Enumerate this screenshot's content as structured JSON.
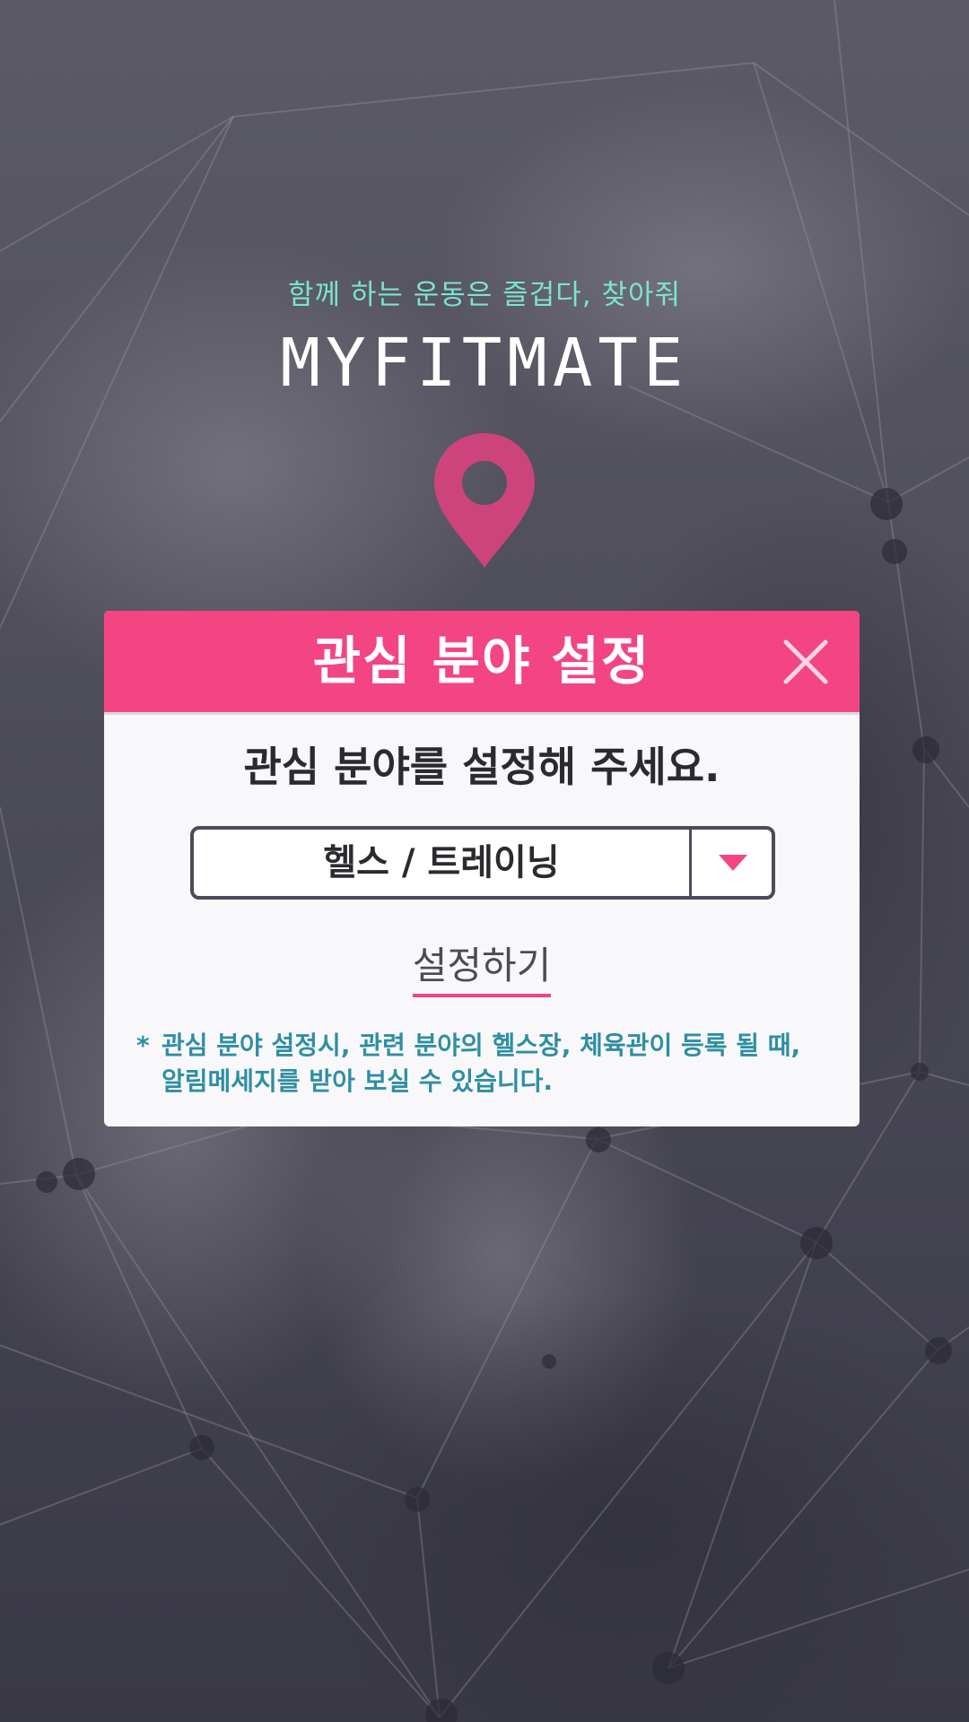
{
  "header": {
    "tagline": "함께 하는 운동은 즐겁다, 찾아줘",
    "brand": "MYFITMATE"
  },
  "icons": {
    "pin": "map-pin-icon",
    "close": "close-icon",
    "dropdown": "triangle-down-icon"
  },
  "modal": {
    "title": "관심 분야 설정",
    "subtitle": "관심 분야를 설정해 주세요.",
    "select": {
      "selected": "헬스 / 트레이닝"
    },
    "submit_label": "설정하기",
    "notice_marker": "*",
    "notice_lines": [
      "관심 분야 설정시, 관련 분야의 헬스장, 체육관이 등록 될 때,",
      "알림메세지를 받아 보실 수 있습니다."
    ]
  },
  "colors": {
    "accent": "#f34584",
    "tagline": "#7ce3cf",
    "notice": "#2f8ea2",
    "modal_bg": "#f8f8fa",
    "background": "#4a4a56"
  }
}
